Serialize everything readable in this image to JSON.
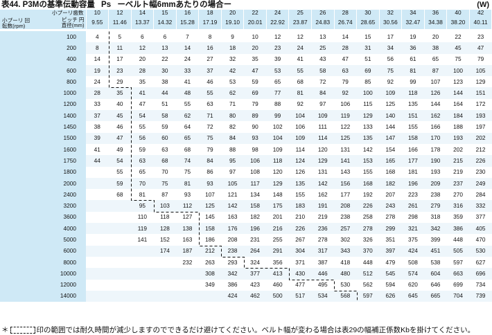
{
  "title": {
    "label": "表44. P3Mの基準伝動容量",
    "symbol": "Ps",
    "subtitle": "ーベルト幅6mmあたりの場合ー"
  },
  "unit": "(W)",
  "header": {
    "teeth_label": "小プーリ歯数",
    "pitch_label": "ピッチ 円直径(mm)",
    "rpm_label": "小プーリ 回転数(rpm)",
    "teeth": [
      "10",
      "12",
      "14",
      "15",
      "16",
      "18",
      "20",
      "22",
      "24",
      "25",
      "26",
      "28",
      "30",
      "32",
      "34",
      "36",
      "40",
      "42"
    ],
    "pitch_diameters": [
      "9.55",
      "11.46",
      "13.37",
      "14.32",
      "15.28",
      "17.19",
      "19.10",
      "20.01",
      "22.92",
      "23.87",
      "24.83",
      "26.74",
      "28.65",
      "30.56",
      "32.47",
      "34.38",
      "38.20",
      "40.11"
    ]
  },
  "rows": [
    {
      "rpm": "100",
      "values": [
        "4",
        "5",
        "6",
        "6",
        "7",
        "8",
        "9",
        "10",
        "12",
        "12",
        "13",
        "14",
        "15",
        "17",
        "19",
        "20",
        "22",
        "23"
      ]
    },
    {
      "rpm": "200",
      "values": [
        "8",
        "11",
        "12",
        "13",
        "14",
        "16",
        "18",
        "20",
        "23",
        "24",
        "25",
        "28",
        "31",
        "34",
        "36",
        "38",
        "45",
        "47"
      ]
    },
    {
      "rpm": "400",
      "values": [
        "14",
        "17",
        "20",
        "22",
        "24",
        "27",
        "32",
        "35",
        "39",
        "41",
        "43",
        "47",
        "51",
        "56",
        "61",
        "65",
        "75",
        "79"
      ]
    },
    {
      "rpm": "600",
      "values": [
        "19",
        "23",
        "28",
        "30",
        "33",
        "37",
        "42",
        "47",
        "53",
        "55",
        "58",
        "63",
        "69",
        "75",
        "81",
        "87",
        "100",
        "105"
      ]
    },
    {
      "rpm": "800",
      "values": [
        "24",
        "29",
        "35",
        "38",
        "41",
        "46",
        "53",
        "59",
        "65",
        "68",
        "72",
        "79",
        "85",
        "92",
        "99",
        "107",
        "123",
        "129"
      ]
    },
    {
      "rpm": "1000",
      "values": [
        "28",
        "35",
        "41",
        "44",
        "48",
        "55",
        "62",
        "69",
        "77",
        "81",
        "84",
        "92",
        "100",
        "109",
        "118",
        "126",
        "144",
        "151"
      ]
    },
    {
      "rpm": "1200",
      "values": [
        "33",
        "40",
        "47",
        "51",
        "55",
        "63",
        "71",
        "79",
        "88",
        "92",
        "97",
        "106",
        "115",
        "125",
        "135",
        "144",
        "164",
        "172"
      ]
    },
    {
      "rpm": "1400",
      "values": [
        "37",
        "45",
        "54",
        "58",
        "62",
        "71",
        "80",
        "89",
        "99",
        "104",
        "109",
        "119",
        "129",
        "140",
        "151",
        "162",
        "184",
        "193"
      ]
    },
    {
      "rpm": "1450",
      "values": [
        "38",
        "46",
        "55",
        "59",
        "64",
        "72",
        "82",
        "90",
        "102",
        "106",
        "111",
        "122",
        "133",
        "144",
        "155",
        "166",
        "188",
        "197"
      ]
    },
    {
      "rpm": "1500",
      "values": [
        "39",
        "47",
        "56",
        "60",
        "65",
        "75",
        "84",
        "93",
        "104",
        "109",
        "114",
        "125",
        "135",
        "147",
        "158",
        "170",
        "193",
        "202"
      ]
    },
    {
      "rpm": "1600",
      "values": [
        "41",
        "49",
        "59",
        "63",
        "68",
        "79",
        "88",
        "98",
        "109",
        "114",
        "120",
        "131",
        "142",
        "154",
        "166",
        "178",
        "202",
        "212"
      ]
    },
    {
      "rpm": "1750",
      "values": [
        "44",
        "54",
        "63",
        "68",
        "74",
        "84",
        "95",
        "106",
        "118",
        "124",
        "129",
        "141",
        "153",
        "165",
        "177",
        "190",
        "215",
        "226"
      ]
    },
    {
      "rpm": "1800",
      "values": [
        "",
        "55",
        "65",
        "70",
        "75",
        "86",
        "97",
        "108",
        "120",
        "126",
        "131",
        "143",
        "155",
        "168",
        "181",
        "193",
        "219",
        "230"
      ]
    },
    {
      "rpm": "2000",
      "values": [
        "",
        "59",
        "70",
        "75",
        "81",
        "93",
        "105",
        "117",
        "129",
        "135",
        "142",
        "156",
        "168",
        "182",
        "196",
        "209",
        "237",
        "249"
      ]
    },
    {
      "rpm": "2400",
      "values": [
        "",
        "68",
        "81",
        "87",
        "93",
        "107",
        "121",
        "134",
        "148",
        "155",
        "162",
        "177",
        "192",
        "207",
        "223",
        "238",
        "270",
        "284"
      ]
    },
    {
      "rpm": "3200",
      "values": [
        "",
        "",
        "95",
        "103",
        "112",
        "125",
        "142",
        "158",
        "175",
        "183",
        "191",
        "208",
        "226",
        "243",
        "261",
        "279",
        "316",
        "332"
      ]
    },
    {
      "rpm": "3600",
      "values": [
        "",
        "",
        "110",
        "118",
        "127",
        "145",
        "163",
        "182",
        "201",
        "210",
        "219",
        "238",
        "258",
        "278",
        "298",
        "318",
        "359",
        "377"
      ]
    },
    {
      "rpm": "4000",
      "values": [
        "",
        "",
        "119",
        "128",
        "138",
        "158",
        "176",
        "196",
        "216",
        "226",
        "236",
        "257",
        "278",
        "299",
        "321",
        "342",
        "386",
        "405"
      ]
    },
    {
      "rpm": "5000",
      "values": [
        "",
        "",
        "141",
        "152",
        "163",
        "186",
        "208",
        "231",
        "255",
        "267",
        "278",
        "302",
        "326",
        "351",
        "375",
        "399",
        "448",
        "470"
      ]
    },
    {
      "rpm": "6000",
      "values": [
        "",
        "",
        "",
        "174",
        "187",
        "212",
        "238",
        "264",
        "291",
        "304",
        "317",
        "343",
        "370",
        "397",
        "424",
        "451",
        "505",
        "530"
      ]
    },
    {
      "rpm": "8000",
      "values": [
        "",
        "",
        "",
        "",
        "232",
        "263",
        "293",
        "324",
        "356",
        "371",
        "387",
        "418",
        "448",
        "479",
        "508",
        "538",
        "597",
        "627"
      ]
    },
    {
      "rpm": "10000",
      "values": [
        "",
        "",
        "",
        "",
        "",
        "308",
        "342",
        "377",
        "413",
        "430",
        "446",
        "480",
        "512",
        "545",
        "574",
        "604",
        "663",
        "696"
      ]
    },
    {
      "rpm": "12000",
      "values": [
        "",
        "",
        "",
        "",
        "",
        "349",
        "386",
        "423",
        "460",
        "477",
        "495",
        "530",
        "562",
        "594",
        "620",
        "646",
        "699",
        "734"
      ]
    },
    {
      "rpm": "14000",
      "values": [
        "",
        "",
        "",
        "",
        "",
        "",
        "424",
        "462",
        "500",
        "517",
        "534",
        "568",
        "597",
        "626",
        "645",
        "665",
        "704",
        "739"
      ]
    }
  ],
  "footnote": {
    "prefix": "＊",
    "text": "印の範囲では耐久時間が減少しますのでできるだけ避けてください。ベルト幅が変わる場合は表29の幅補正係数Kbを掛けてください。"
  }
}
